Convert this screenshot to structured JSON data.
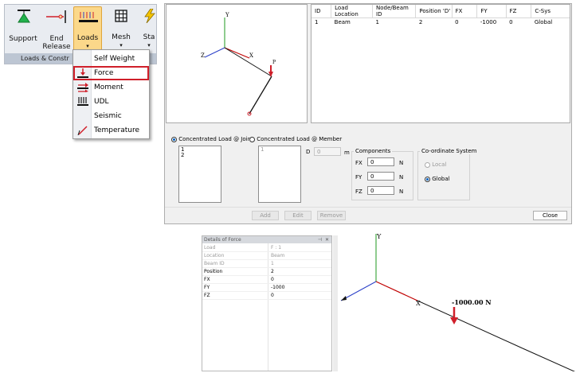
{
  "ribbon": {
    "support_label": "Support",
    "end_release_label_1": "End",
    "end_release_label_2": "Release",
    "loads_label": "Loads",
    "mesh_label": "Mesh",
    "sta_label": "Sta",
    "group_label": "Loads & Constr"
  },
  "menu": {
    "items": [
      {
        "label": "Self Weight",
        "icon": "self-weight-icon"
      },
      {
        "label": "Force",
        "icon": "force-arrow-icon"
      },
      {
        "label": "Moment",
        "icon": "moment-icon"
      },
      {
        "label": "UDL",
        "icon": "udl-icon"
      },
      {
        "label": "Seismic",
        "icon": ""
      },
      {
        "label": "Temperature",
        "icon": "temperature-icon"
      }
    ],
    "highlight_color": "#d01f2a"
  },
  "viewport1": {
    "axis_y": "Y",
    "axis_x": "X",
    "axis_z": "Z",
    "load_label": "P"
  },
  "grid": {
    "columns": [
      "ID",
      "Load Location",
      "Node/Beam ID",
      "Position 'D'",
      "FX",
      "FY",
      "FZ",
      "C-Sys"
    ],
    "rows": [
      [
        "1",
        "Beam",
        "1",
        "2",
        "0",
        "-1000",
        "0",
        "Global"
      ]
    ]
  },
  "form": {
    "radio_joint": "Concentrated Load @ Joint",
    "radio_member": "Concentrated Load @ Member",
    "joint_list": [
      "1",
      "2"
    ],
    "member_list": [
      "1"
    ],
    "d_label": "D",
    "d_value": "0",
    "d_unit": "m",
    "components_title": "Components",
    "fx_label": "FX",
    "fx_value": "0",
    "fy_label": "FY",
    "fy_value": "0",
    "fz_label": "FZ",
    "fz_value": "0",
    "unit_n": "N",
    "csys_title": "Co-ordinate System",
    "local_label": "Local",
    "global_label": "Global"
  },
  "buttons": {
    "add": "Add",
    "edit": "Edit",
    "remove": "Remove",
    "close": "Close"
  },
  "details": {
    "title": "Details of Force",
    "rows": [
      {
        "key": "Load",
        "value": "F : 1",
        "readonly": true
      },
      {
        "key": "Location",
        "value": "Beam",
        "readonly": true
      },
      {
        "key": "Beam ID",
        "value": "1",
        "readonly": true
      },
      {
        "key": "Position",
        "value": "2",
        "readonly": false
      },
      {
        "key": "FX",
        "value": "0",
        "readonly": false
      },
      {
        "key": "FY",
        "value": "-1000",
        "readonly": false
      },
      {
        "key": "FZ",
        "value": "0",
        "readonly": false
      }
    ]
  },
  "viewport2": {
    "axis_y": "Y",
    "axis_x": "X",
    "load_label": "-1000.00 N"
  },
  "colors": {
    "axis_x": "#c00000",
    "axis_y": "#1f9a1f",
    "axis_z": "#2a3fc8",
    "load": "#d01f2a",
    "selection": "#0060c0"
  }
}
